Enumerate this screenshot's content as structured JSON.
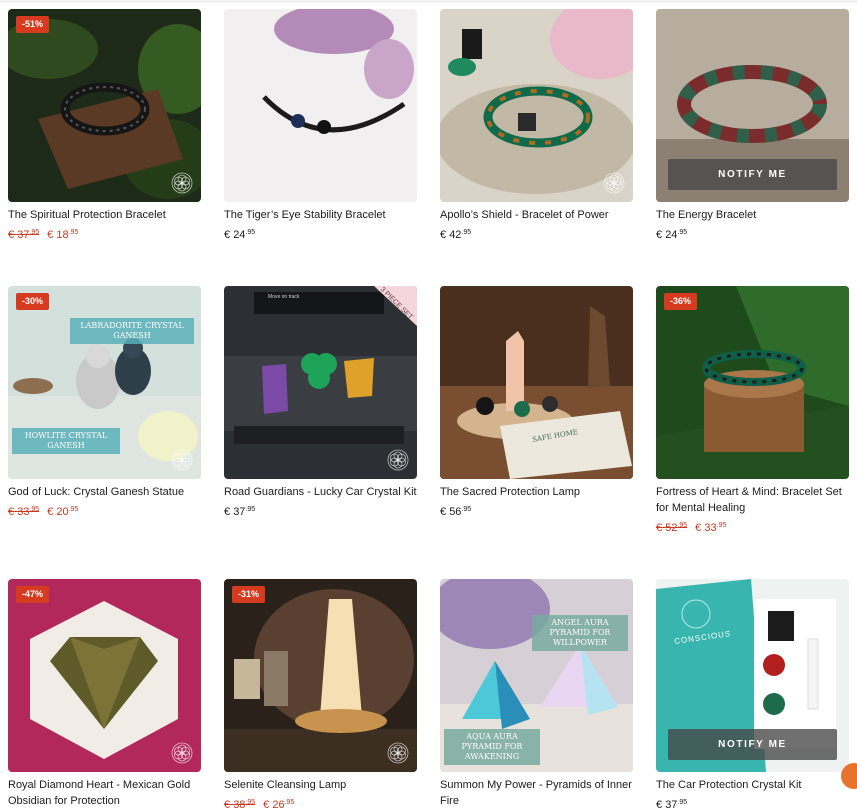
{
  "currency": "€",
  "notify_label": "NOTIFY ME",
  "products": [
    {
      "title": "The Spiritual Protection Bracelet",
      "badge": "-51%",
      "old_price": "37",
      "old_cents": ".95",
      "price": "18",
      "price_cents": ".95",
      "sale": true,
      "notify": false,
      "icon": "bracelet-photo-icon"
    },
    {
      "title": "The Tiger’s Eye Stability Bracelet",
      "badge": "",
      "price": "24",
      "price_cents": ".95",
      "sale": false,
      "notify": false,
      "icon": "bracelet-photo-icon"
    },
    {
      "title": "Apollo’s Shield - Bracelet of Power",
      "badge": "",
      "price": "42",
      "price_cents": ".95",
      "sale": false,
      "notify": false,
      "icon": "bracelet-photo-icon"
    },
    {
      "title": "The Energy Bracelet",
      "badge": "",
      "price": "24",
      "price_cents": ".95",
      "sale": false,
      "notify": true,
      "icon": "bracelet-photo-icon"
    },
    {
      "title": "God of Luck: Crystal Ganesh Statue",
      "badge": "-30%",
      "old_price": "33",
      "old_cents": ".95",
      "price": "20",
      "price_cents": ".95",
      "sale": true,
      "notify": false,
      "icon": "statue-photo-icon",
      "tags": [
        "LABRADORITE CRYSTAL GANESH",
        "HOWLITE CRYSTAL GANESH"
      ]
    },
    {
      "title": "Road Guardians - Lucky Car Crystal Kit",
      "badge": "",
      "price": "37",
      "price_cents": ".95",
      "sale": false,
      "notify": false,
      "icon": "car-crystal-photo-icon",
      "ribbon": "3 PIECE SET",
      "screen_text": "Move on track"
    },
    {
      "title": "The Sacred Protection Lamp",
      "badge": "",
      "price": "56",
      "price_cents": ".95",
      "sale": false,
      "notify": false,
      "icon": "lamp-photo-icon",
      "card_text": "SAFE HOME"
    },
    {
      "title": "Fortress of Heart & Mind: Bracelet Set for Mental Healing",
      "badge": "-36%",
      "old_price": "52",
      "old_cents": ".95",
      "price": "33",
      "price_cents": ".95",
      "sale": true,
      "notify": false,
      "icon": "bracelet-set-photo-icon"
    },
    {
      "title": "Royal Diamond Heart - Mexican Gold Obsidian for Protection",
      "badge": "-47%",
      "old_price": "",
      "old_cents": "",
      "price": "",
      "price_cents": "",
      "sale": true,
      "notify": false,
      "icon": "heart-stone-photo-icon"
    },
    {
      "title": "Selenite Cleansing Lamp",
      "badge": "-31%",
      "old_price": "38",
      "old_cents": ".95",
      "price": "26",
      "price_cents": ".95",
      "sale": true,
      "notify": false,
      "icon": "selenite-lamp-photo-icon"
    },
    {
      "title": "Summon My Power - Pyramids of Inner Fire",
      "badge": "",
      "price": "",
      "price_cents": "",
      "sale": false,
      "notify": false,
      "icon": "pyramid-photo-icon",
      "tags": [
        "ANGEL AURA PYRAMID FOR WILLPOWER",
        "AQUA AURA PYRAMID FOR AWAKENING"
      ]
    },
    {
      "title": "The Car Protection Crystal Kit",
      "badge": "",
      "price": "37",
      "price_cents": ".95",
      "sale": false,
      "notify": true,
      "icon": "crystal-kit-photo-icon",
      "box_text": "CONSCIOUS"
    }
  ]
}
